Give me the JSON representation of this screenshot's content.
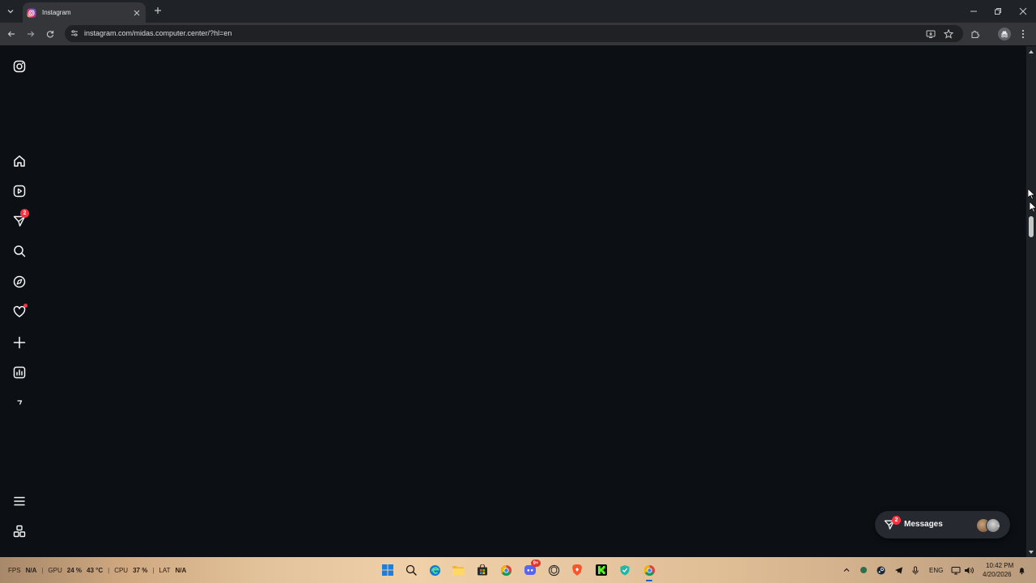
{
  "browser": {
    "tab": {
      "title": "Instagram"
    },
    "url": "instagram.com/midas.computer.center/?hl=en"
  },
  "sidebar": {
    "items": [
      {
        "name": "instagram-logo",
        "icon": "instagram-icon"
      },
      {
        "name": "home",
        "icon": "home-icon"
      },
      {
        "name": "reels",
        "icon": "reels-icon"
      },
      {
        "name": "messages",
        "icon": "messages-icon",
        "badge": "2"
      },
      {
        "name": "search",
        "icon": "search-icon"
      },
      {
        "name": "explore",
        "icon": "compass-icon"
      },
      {
        "name": "notifications",
        "icon": "heart-icon",
        "dot": true
      },
      {
        "name": "create",
        "icon": "plus-icon"
      },
      {
        "name": "dashboard",
        "icon": "chart-icon"
      },
      {
        "name": "threads",
        "icon": "threads-icon"
      },
      {
        "name": "more",
        "icon": "menu-icon"
      },
      {
        "name": "also-from-meta",
        "icon": "apps-icon"
      }
    ]
  },
  "messages_pill": {
    "label": "Messages",
    "badge": "2"
  },
  "taskbar": {
    "perf": {
      "fps_label": "FPS",
      "fps_value": "N/A",
      "gpu_label": "GPU",
      "gpu_value": "24 %",
      "gpu_temp": "43 °C",
      "cpu_label": "CPU",
      "cpu_value": "37 %",
      "lat_label": "LAT",
      "lat_value": "N/A"
    },
    "apps": [
      "start",
      "search",
      "edge",
      "file-explorer",
      "microsoft-store",
      "chrome",
      "discord",
      "chatgpt",
      "brave",
      "kick",
      "vpn",
      "chrome-profile"
    ],
    "discord_badge": "9+",
    "tray": {
      "language": "ENG",
      "time": "10:42 PM",
      "date": "4/20/2026"
    }
  },
  "colors": {
    "background": "#0c1014",
    "notification_red": "#ff3040",
    "chrome_toolbar": "#35363a"
  }
}
